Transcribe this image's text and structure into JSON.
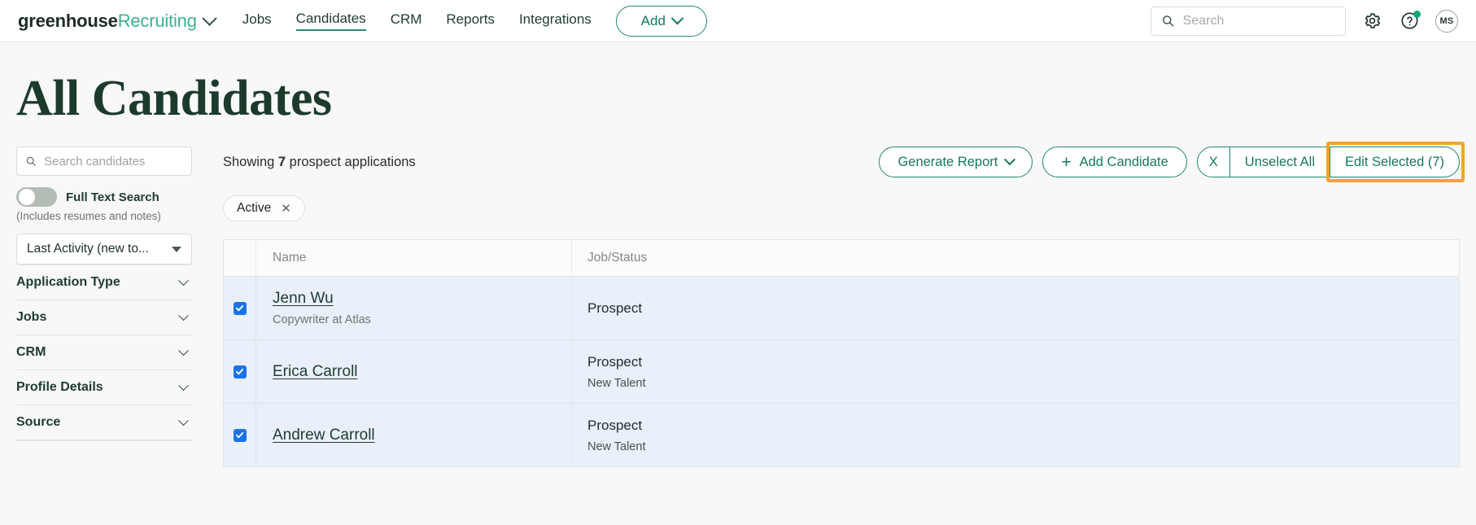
{
  "header": {
    "brand_primary": "greenhouse",
    "brand_secondary": "Recruiting",
    "nav": [
      {
        "label": "Jobs",
        "active": false
      },
      {
        "label": "Candidates",
        "active": true
      },
      {
        "label": "CRM",
        "active": false
      },
      {
        "label": "Reports",
        "active": false
      },
      {
        "label": "Integrations",
        "active": false
      }
    ],
    "add_button": "Add",
    "search_placeholder": "Search",
    "search_value": "",
    "avatar_initials": "MS",
    "accent_green": "#2a8a63",
    "brand_green": "#3db387"
  },
  "page": {
    "title": "All Candidates"
  },
  "sidebar": {
    "search_placeholder": "Search candidates",
    "search_value": "",
    "full_text_search_label": "Full Text Search",
    "full_text_search_sub": "(Includes resumes and notes)",
    "full_text_search_on": false,
    "sort_value": "Last Activity (new to...",
    "facets": [
      {
        "label": "Application Type"
      },
      {
        "label": "Jobs"
      },
      {
        "label": "CRM"
      },
      {
        "label": "Profile Details"
      },
      {
        "label": "Source"
      }
    ]
  },
  "main": {
    "showing_prefix": "Showing",
    "showing_count": "7",
    "showing_suffix": "prospect applications",
    "toolbar": {
      "generate_report": "Generate Report",
      "add_candidate": "Add Candidate",
      "unselect_x": "X",
      "unselect_all": "Unselect All",
      "edit_selected": "Edit Selected (7)",
      "highlight_color": "#f5a623"
    },
    "filter_chips": [
      {
        "label": "Active",
        "remove_icon": "close-icon"
      }
    ],
    "table": {
      "columns": [
        "Name",
        "Job/Status"
      ],
      "rows": [
        {
          "checked": true,
          "name": "Jenn Wu",
          "subtitle": "Copywriter at Atlas",
          "job": "Prospect",
          "job_sub": ""
        },
        {
          "checked": true,
          "name": "Erica Carroll",
          "subtitle": "",
          "job": "Prospect",
          "job_sub": "New Talent"
        },
        {
          "checked": true,
          "name": "Andrew Carroll",
          "subtitle": "",
          "job": "Prospect",
          "job_sub": "New Talent"
        }
      ]
    }
  }
}
